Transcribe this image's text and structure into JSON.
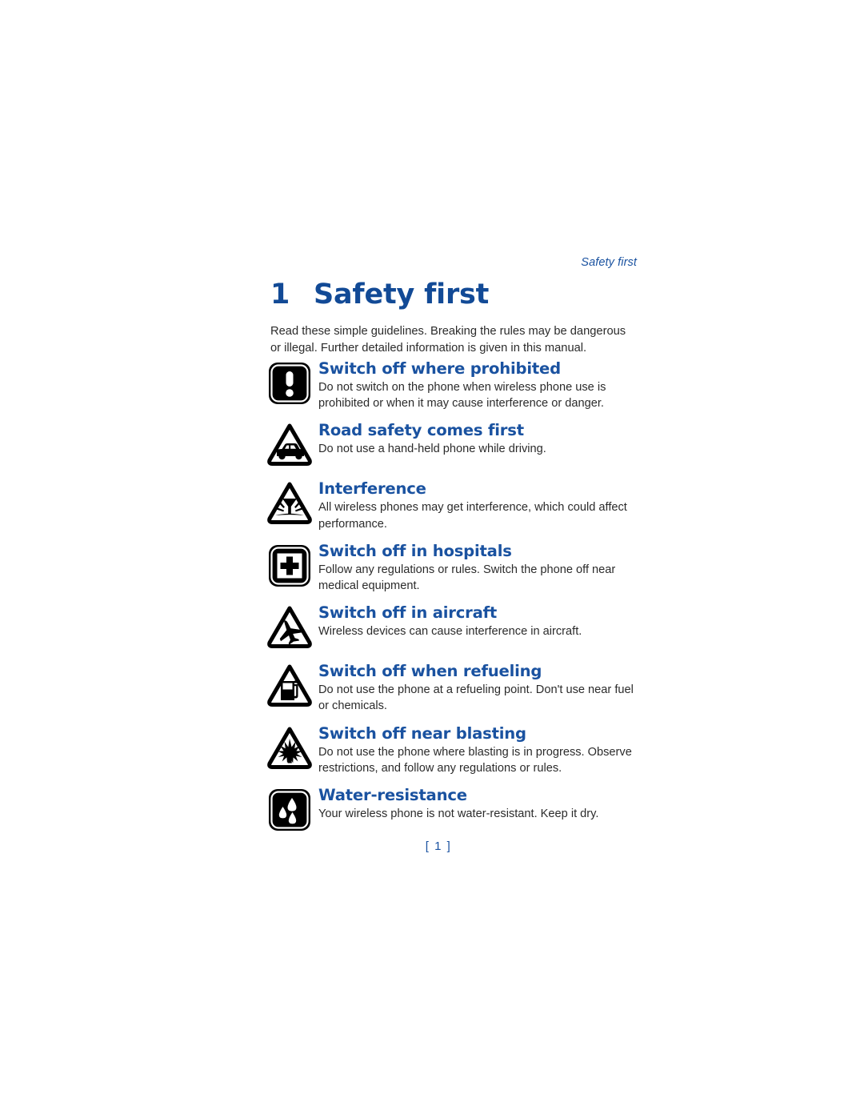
{
  "document": {
    "running_head": "Safety first",
    "chapter_number": "1",
    "chapter_title": "Safety first",
    "intro": "Read these simple guidelines. Breaking the rules may be dangerous or illegal. Further detailed information is given in this manual.",
    "page_number": "[ 1 ]",
    "colors": {
      "heading_blue": "#1a52a0",
      "title_blue": "#124a96",
      "body_text": "#2b2b2b",
      "icon_black": "#000000",
      "page_background": "#ffffff"
    }
  },
  "guidelines": [
    {
      "icon": "exclamation-square-icon",
      "title": "Switch off where prohibited",
      "body": "Do not switch on the phone when wireless phone use is prohibited or when it may cause interference or danger."
    },
    {
      "icon": "car-triangle-icon",
      "title": "Road safety comes first",
      "body": "Do not use a hand-held phone while driving."
    },
    {
      "icon": "interference-triangle-icon",
      "title": "Interference",
      "body": "All wireless phones may get interference, which could affect performance."
    },
    {
      "icon": "hospital-cross-square-icon",
      "title": "Switch off in hospitals",
      "body": "Follow any regulations or rules. Switch the phone off near medical equipment."
    },
    {
      "icon": "aircraft-triangle-icon",
      "title": "Switch off in aircraft",
      "body": "Wireless devices can cause interference in aircraft."
    },
    {
      "icon": "fuel-pump-triangle-icon",
      "title": "Switch off when refueling",
      "body": "Do not use the phone at a refueling point. Don't use near fuel or chemicals."
    },
    {
      "icon": "blasting-triangle-icon",
      "title": "Switch off near blasting",
      "body": "Do not use the phone where blasting is in progress. Observe restrictions, and follow any regulations or rules."
    },
    {
      "icon": "water-drops-square-icon",
      "title": "Water-resistance",
      "body": "Your wireless phone is not water-resistant. Keep it dry."
    }
  ]
}
